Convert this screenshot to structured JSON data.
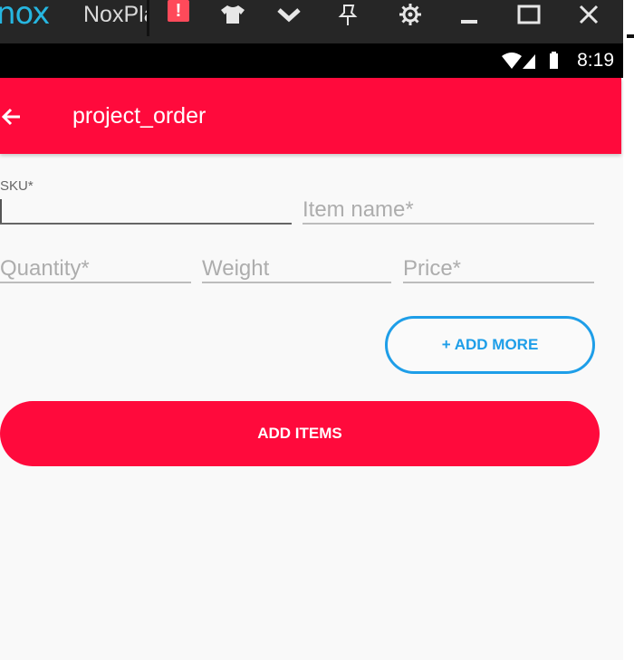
{
  "emulator": {
    "logo": "nox",
    "title": "NoxPlayer",
    "icons": [
      "alert-icon",
      "shirt-icon",
      "chevron-down-icon",
      "pin-icon",
      "gear-icon",
      "minimize-icon",
      "maximize-icon",
      "close-icon"
    ],
    "alert_glyph": "!"
  },
  "status_bar": {
    "time": "8:19",
    "icons": [
      "wifi-icon",
      "signal-icon",
      "battery-icon"
    ]
  },
  "toolbar": {
    "title": "project_order",
    "back_icon": "back-arrow-icon"
  },
  "form": {
    "sku": {
      "label": "SKU*",
      "value": ""
    },
    "item_name": {
      "placeholder": "Item name*",
      "value": ""
    },
    "quantity": {
      "placeholder": "Quantity*",
      "value": ""
    },
    "weight": {
      "placeholder": "Weight",
      "value": ""
    },
    "price": {
      "placeholder": "Price*",
      "value": ""
    }
  },
  "buttons": {
    "add_more": "+ ADD MORE",
    "add_items": "ADD ITEMS"
  },
  "colors": {
    "primary": "#ff0a3c",
    "accent": "#1e9ee8",
    "background": "#f9f9f9"
  }
}
